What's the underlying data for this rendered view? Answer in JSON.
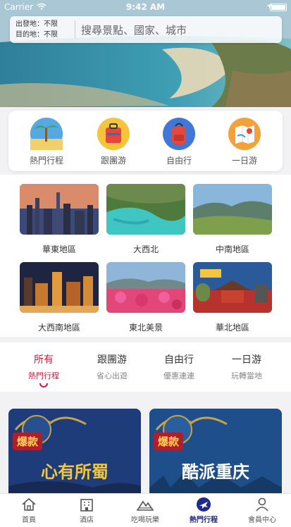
{
  "status_bar": {
    "carrier": "Carrier",
    "time": "9:42 AM"
  },
  "search": {
    "departure_label": "出發地：",
    "departure_value": "不限",
    "destination_label": "目的地：",
    "destination_value": "不限",
    "placeholder": "搜尋景點、國家、城市"
  },
  "categories": [
    {
      "label": "熱門行程",
      "icon": "palm-tree-icon"
    },
    {
      "label": "跟團游",
      "icon": "luggage-icon"
    },
    {
      "label": "自由行",
      "icon": "backpack-icon"
    },
    {
      "label": "一日游",
      "icon": "map-icon"
    }
  ],
  "regions": [
    {
      "name": "華東地區"
    },
    {
      "name": "大西北"
    },
    {
      "name": "中南地區"
    },
    {
      "name": "大西南地區"
    },
    {
      "name": "東北美景"
    },
    {
      "name": "華北地區"
    }
  ],
  "tabs": [
    {
      "title": "所有",
      "subtitle": "熱門行程",
      "active": true
    },
    {
      "title": "跟團游",
      "subtitle": "省心出遊",
      "active": false
    },
    {
      "title": "自由行",
      "subtitle": "優惠連連",
      "active": false
    },
    {
      "title": "一日游",
      "subtitle": "玩轉當地",
      "active": false
    }
  ],
  "products": [
    {
      "badge": "爆款",
      "headline": "心有所蜀"
    },
    {
      "badge": "爆款",
      "headline": "酷派重庆"
    }
  ],
  "bottom_nav": [
    {
      "label": "首頁",
      "icon": "home-icon",
      "active": false
    },
    {
      "label": "酒店",
      "icon": "hotel-icon",
      "active": false
    },
    {
      "label": "吃喝玩樂",
      "icon": "mountain-icon",
      "active": false
    },
    {
      "label": "熱門行程",
      "icon": "plane-icon",
      "active": true
    },
    {
      "label": "會員中心",
      "icon": "user-icon",
      "active": false
    }
  ],
  "colors": {
    "accent": "#d01a3a",
    "nav_active": "#1e2b8a"
  }
}
